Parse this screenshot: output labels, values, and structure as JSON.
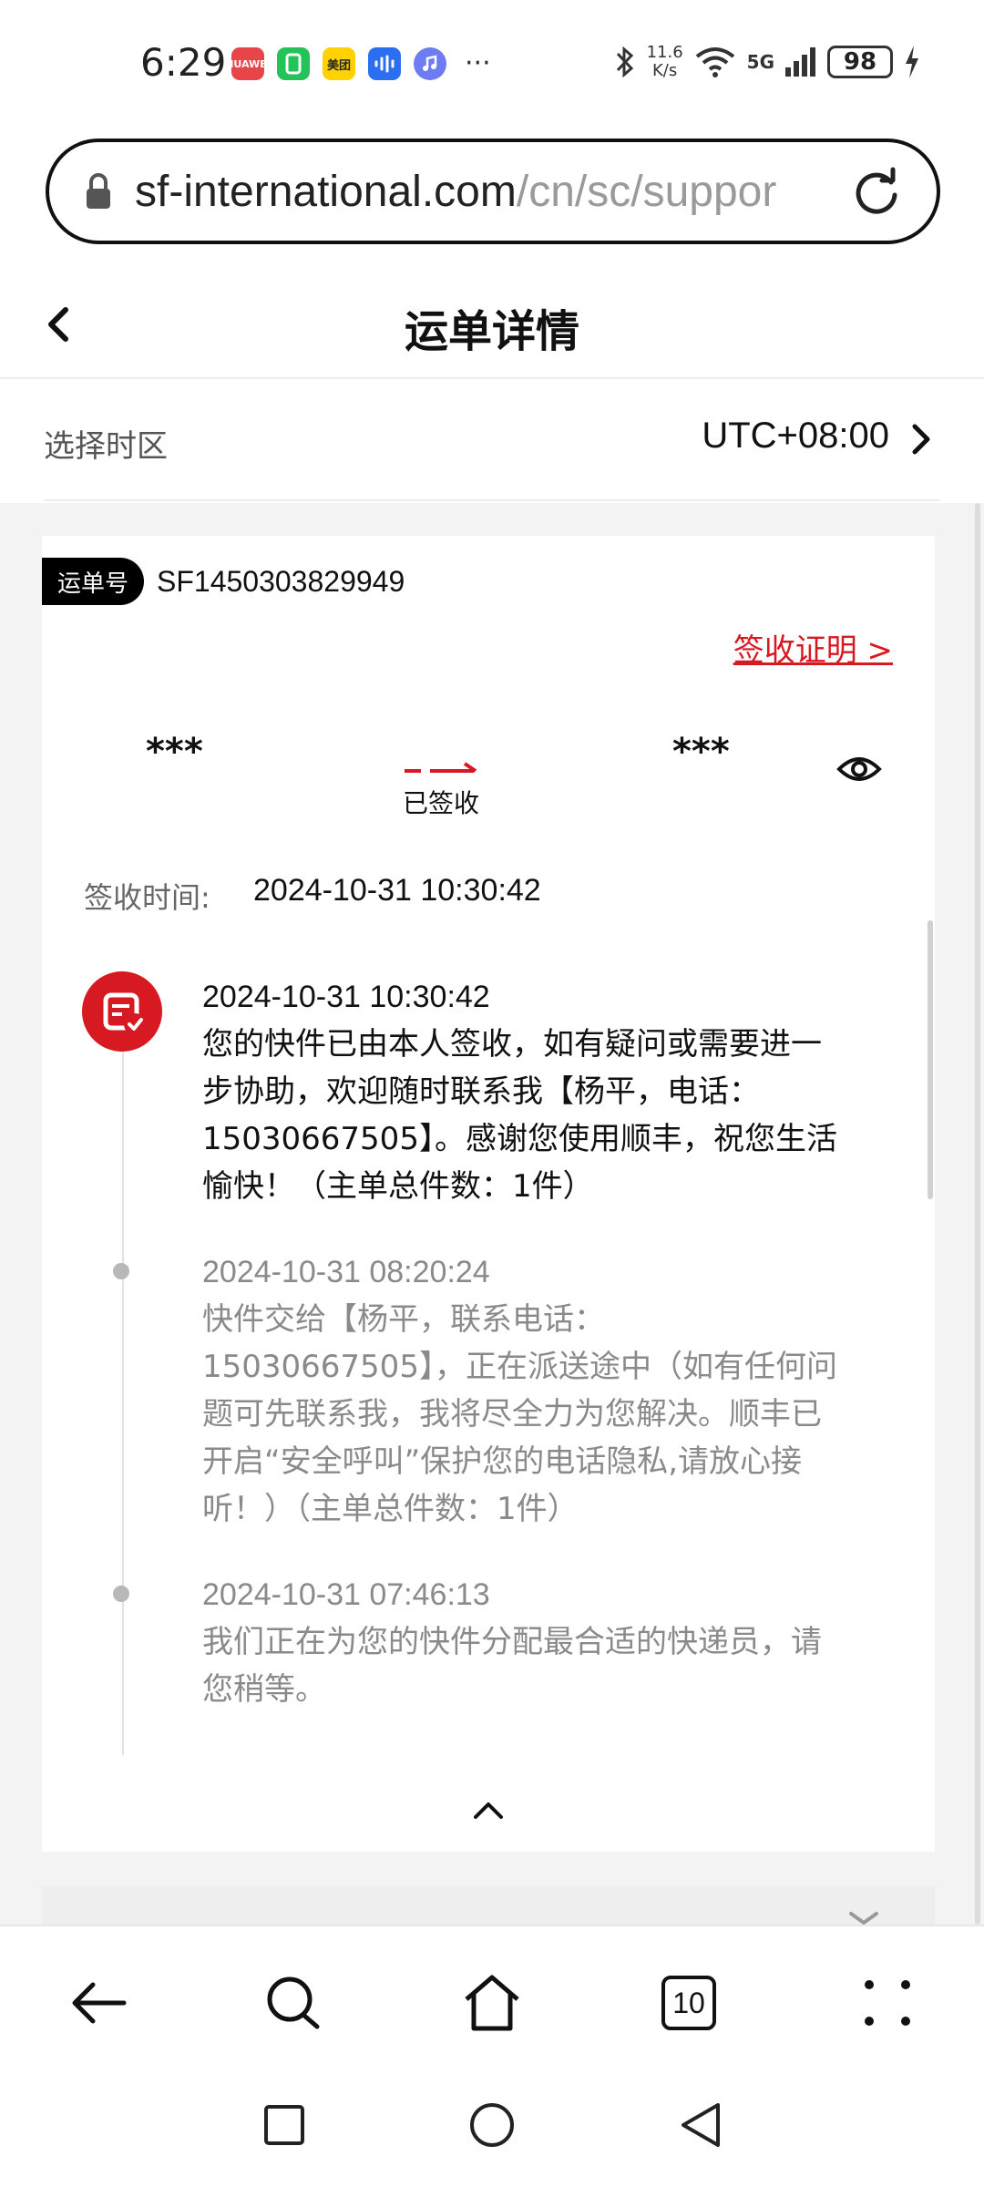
{
  "status_bar": {
    "time": "6:29",
    "apps": [
      {
        "icon": "huawei-store-icon",
        "label": "HUAWEI",
        "color": "#e8454b"
      },
      {
        "icon": "green-app-icon",
        "label": "",
        "color": "#23c35a"
      },
      {
        "icon": "meituan-icon",
        "label": "美团",
        "color": "#ffd100"
      },
      {
        "icon": "voice-app-icon",
        "label": "",
        "color": "#2b6ef0"
      },
      {
        "icon": "music-app-icon",
        "label": "",
        "color": "#6d7cf0"
      }
    ],
    "more": "···",
    "net_speed_value": "11.6",
    "net_speed_unit": "K/s",
    "network": "5G",
    "battery": "98"
  },
  "url_bar": {
    "host": "sf-international.com",
    "path": "/cn/sc/suppor"
  },
  "header": {
    "title": "运单详情"
  },
  "timezone": {
    "label": "选择时区",
    "value": "UTC+08:00"
  },
  "waybill": {
    "tag": "运单号",
    "number": "SF1450303829949",
    "proof_link": "签收证明 >",
    "from": "***",
    "to": "***",
    "status": "已签收",
    "sign_time_label": "签收时间:",
    "sign_time_value": "2024-10-31 10:30:42"
  },
  "timeline": [
    {
      "time": "2024-10-31 10:30:42",
      "text": "您的快件已由本人签收，如有疑问或需要进一步协助，欢迎随时联系我【杨平，电话：15030667505】。感谢您使用顺丰，祝您生活愉快！（主单总件数：1件）"
    },
    {
      "time": "2024-10-31 08:20:24",
      "text": "快件交给【杨平，联系电话：15030667505】，正在派送途中（如有任何问题可先联系我，我将尽全力为您解决。顺丰已开启“安全呼叫”保护您的电话隐私,请放心接听！）（主单总件数：1件）"
    },
    {
      "time": "2024-10-31 07:46:13",
      "text": "我们正在为您的快件分配最合适的快递员，请您稍等。"
    }
  ],
  "browser_nav": {
    "tabs_count": "10"
  },
  "colors": {
    "brand_red": "#d71921",
    "background_gray": "#f3f3f3"
  }
}
